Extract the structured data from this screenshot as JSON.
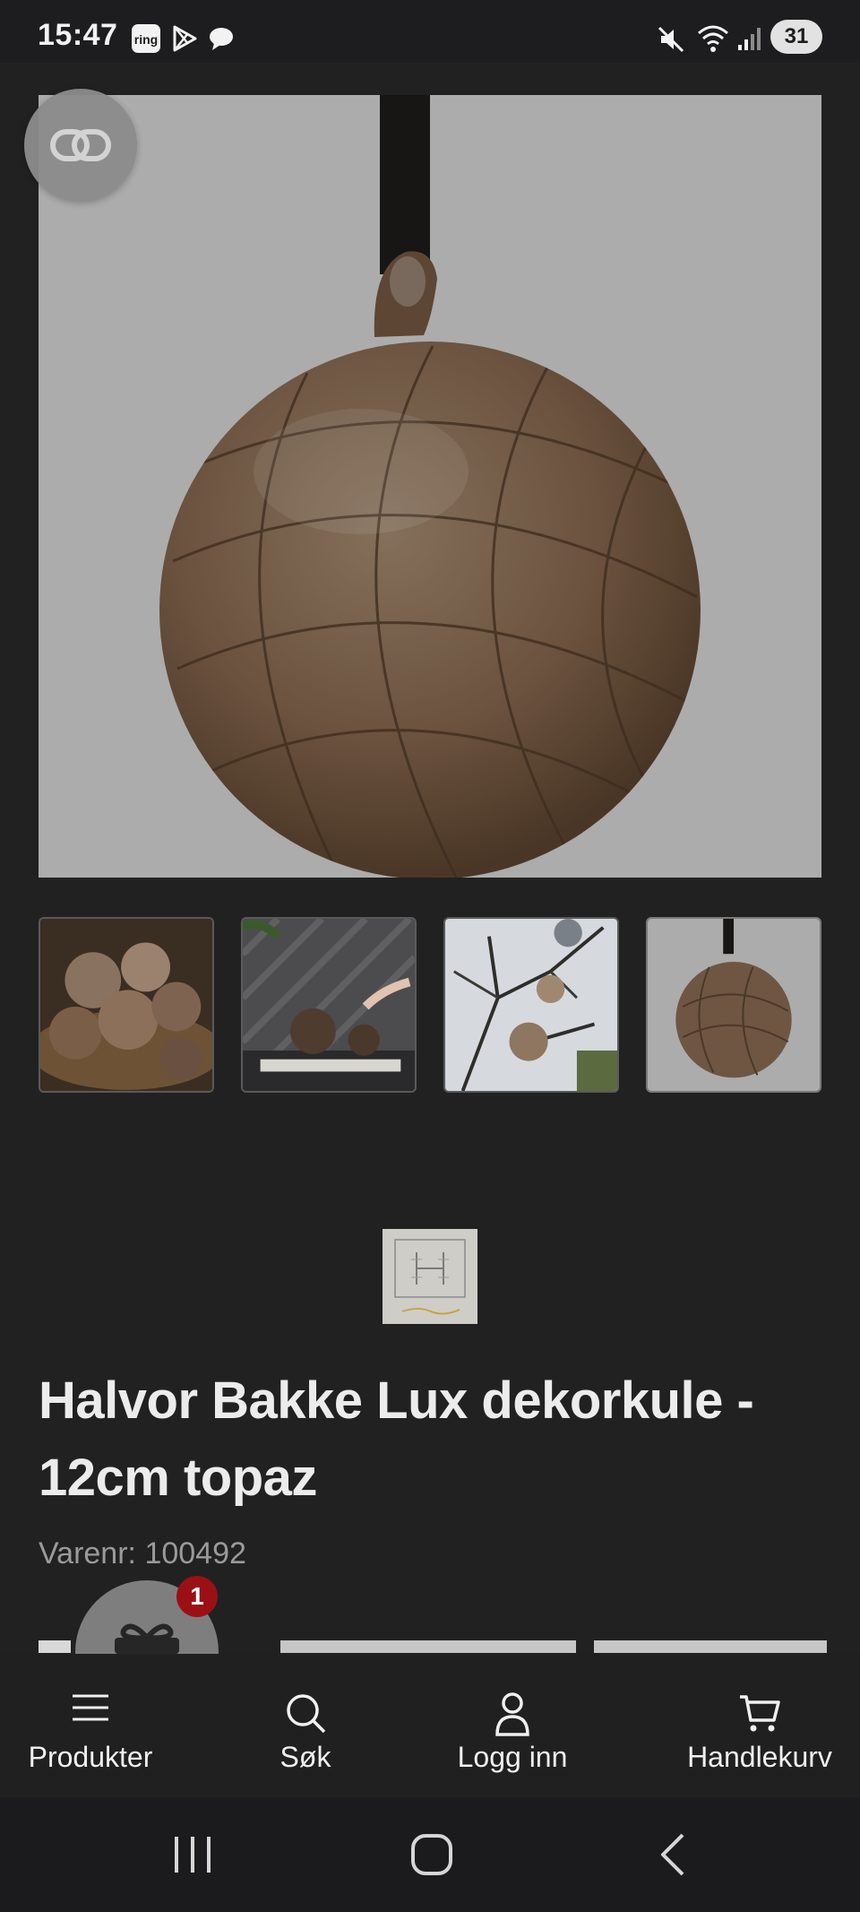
{
  "status_bar": {
    "time": "15:47",
    "notification_icons": [
      "ring-icon",
      "play-store-icon",
      "chat-bubble-icon"
    ],
    "system_icons": [
      "mute-icon",
      "wifi-icon",
      "signal-icon"
    ],
    "battery": "31"
  },
  "product": {
    "title": "Halvor Bakke Lux dekorkule - 12cm topaz",
    "sku_label": "Varenr:",
    "sku_value": "100492",
    "main_image_icon": "glass-bauble-image",
    "compare_icon": "link-icon",
    "thumbnails": [
      {
        "name": "thumbnail-bowl-of-baubles"
      },
      {
        "name": "thumbnail-baubles-on-table"
      },
      {
        "name": "thumbnail-baubles-on-tree"
      },
      {
        "name": "thumbnail-single-bauble"
      }
    ],
    "selected_thumbnail": 4
  },
  "gift": {
    "badge_count": "1",
    "icon": "gift-icon"
  },
  "bottom_nav": {
    "items": [
      {
        "label": "Produkter",
        "icon": "menu-icon"
      },
      {
        "label": "Søk",
        "icon": "search-icon"
      },
      {
        "label": "Logg inn",
        "icon": "user-icon"
      },
      {
        "label": "Handlekurv",
        "icon": "cart-icon"
      }
    ]
  },
  "system_nav": {
    "buttons": [
      "recents-icon",
      "home-icon",
      "back-icon"
    ]
  },
  "colors": {
    "page_background": "#212121",
    "badge": "#9b1015",
    "bauble": "#6b5340"
  }
}
